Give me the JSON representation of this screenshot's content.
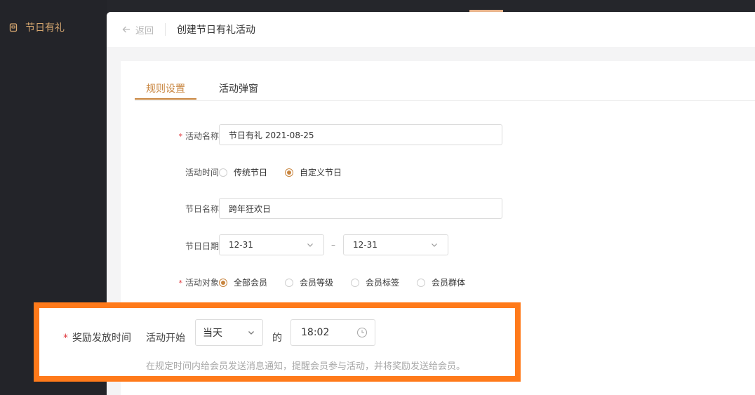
{
  "sidebar": {
    "items": [
      {
        "label": "节日有礼",
        "icon": "gift-icon"
      }
    ]
  },
  "header": {
    "back_label": "返回",
    "title": "创建节日有礼活动"
  },
  "tabs": [
    {
      "label": "规则设置",
      "active": true
    },
    {
      "label": "活动弹窗",
      "active": false
    }
  ],
  "form": {
    "activity_name": {
      "label": "活动名称",
      "required": true,
      "value": "节日有礼  2021-08-25"
    },
    "activity_time": {
      "label": "活动时间",
      "options": [
        {
          "label": "传统节日",
          "checked": false
        },
        {
          "label": "自定义节日",
          "checked": true
        }
      ]
    },
    "festival_name": {
      "label": "节日名称",
      "value": "跨年狂欢日"
    },
    "festival_date": {
      "label": "节日日期",
      "start": "12-31",
      "separator": "–",
      "end": "12-31"
    },
    "target": {
      "label": "活动对象",
      "required": true,
      "options": [
        {
          "label": "全部会员",
          "checked": true
        },
        {
          "label": "会员等级",
          "checked": false
        },
        {
          "label": "会员标签",
          "checked": false
        },
        {
          "label": "会员群体",
          "checked": false
        }
      ]
    },
    "reward_time": {
      "label": "奖励发放时间",
      "required": true,
      "prefix": "活动开始",
      "day_value": "当天",
      "connector": "的",
      "time_value": "18:02",
      "hint": "在规定时间内给会员发送消息通知，提醒会员参与活动，并将奖励发送给会员。"
    }
  },
  "colors": {
    "accent": "#c8853f",
    "highlight": "#ff7a1a",
    "required": "#e0383e",
    "sidebar_bg": "#232429"
  }
}
